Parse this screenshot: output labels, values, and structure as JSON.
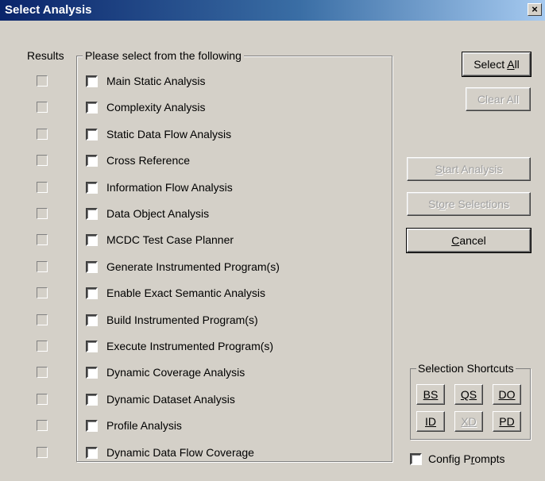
{
  "window": {
    "title": "Select Analysis",
    "close_glyph": "×"
  },
  "results_label": "Results",
  "group_label": "Please select from the following",
  "options": [
    "Main Static Analysis",
    "Complexity Analysis",
    "Static Data Flow Analysis",
    "Cross Reference",
    "Information Flow Analysis",
    "Data Object Analysis",
    "MCDC Test Case Planner",
    "Generate Instrumented Program(s)",
    "Enable Exact Semantic Analysis",
    "Build Instrumented Program(s)",
    "Execute Instrumented Program(s)",
    "Dynamic Coverage Analysis",
    "Dynamic Dataset Analysis",
    "Profile Analysis",
    "Dynamic Data Flow Coverage"
  ],
  "buttons": {
    "select_all": {
      "pre": "Select ",
      "accel": "A",
      "post": "ll"
    },
    "clear_all": "Clear All",
    "start_analysis": {
      "pre": "",
      "accel": "S",
      "post": "tart Analysis"
    },
    "store_selections": {
      "pre": "St",
      "accel": "o",
      "post": "re Selections"
    },
    "cancel": {
      "pre": "",
      "accel": "C",
      "post": "ancel"
    }
  },
  "shortcuts": {
    "label": "Selection Shortcuts",
    "buttons": [
      "BS",
      "QS",
      "DO",
      "ID",
      "XD",
      "PD"
    ],
    "disabled": [
      "XD"
    ]
  },
  "config_prompts": {
    "pre": "Config P",
    "accel": "r",
    "post": "ompts"
  }
}
